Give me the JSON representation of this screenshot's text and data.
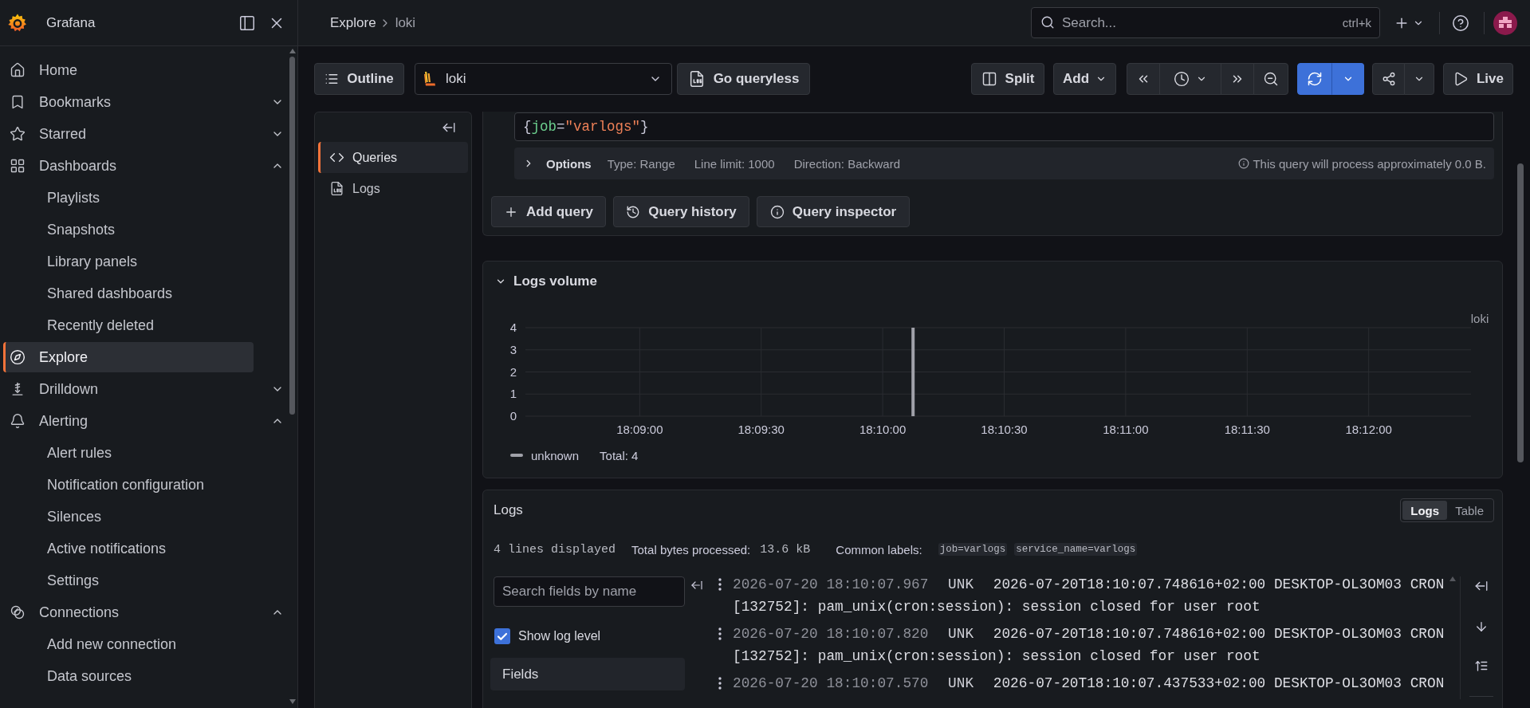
{
  "sidebar": {
    "title": "Grafana",
    "items": [
      {
        "label": "Home",
        "selected": false
      },
      {
        "label": "Bookmarks",
        "selected": false,
        "expanded": false
      },
      {
        "label": "Starred",
        "selected": false,
        "expanded": false
      },
      {
        "label": "Dashboards",
        "selected": false,
        "expanded": true,
        "children": [
          {
            "label": "Playlists",
            "selected": false
          },
          {
            "label": "Snapshots",
            "selected": false
          },
          {
            "label": "Library panels",
            "selected": false
          },
          {
            "label": "Shared dashboards",
            "selected": false
          },
          {
            "label": "Recently deleted",
            "selected": false
          }
        ]
      },
      {
        "label": "Explore",
        "selected": true
      },
      {
        "label": "Drilldown",
        "selected": false,
        "expanded": false
      },
      {
        "label": "Alerting",
        "selected": false,
        "expanded": true,
        "children": [
          {
            "label": "Alert rules",
            "selected": false
          },
          {
            "label": "Notification configuration",
            "selected": false
          },
          {
            "label": "Silences",
            "selected": false
          },
          {
            "label": "Active notifications",
            "selected": false
          },
          {
            "label": "Settings",
            "selected": false
          }
        ]
      },
      {
        "label": "Connections",
        "selected": false,
        "expanded": true,
        "children": [
          {
            "label": "Add new connection",
            "selected": false
          },
          {
            "label": "Data sources",
            "selected": false
          }
        ]
      }
    ]
  },
  "top_bar": {
    "breadcrumbs": [
      {
        "label": "Explore",
        "current": false
      },
      {
        "label": "loki",
        "current": true
      }
    ],
    "search": {
      "placeholder": "Search...",
      "shortcut": "ctrl+k"
    }
  },
  "toolbar": {
    "outline_button": "Outline",
    "datasource": "loki",
    "queryless_button": "Go queryless",
    "split_button": "Split",
    "add_button": "Add",
    "live_button": "Live"
  },
  "outline": {
    "items": [
      {
        "label": "Queries",
        "selected": true
      },
      {
        "label": "Logs",
        "selected": false
      }
    ]
  },
  "query": {
    "tokens": [
      {
        "kind": "punct",
        "text": "{"
      },
      {
        "kind": "label",
        "text": "job"
      },
      {
        "kind": "operator",
        "text": "="
      },
      {
        "kind": "string",
        "text": "\"varlogs\""
      },
      {
        "kind": "punct",
        "text": "}"
      }
    ],
    "options": {
      "label": "Options",
      "expanded": false,
      "summary": [
        "Type: Range",
        "Line limit: 1000",
        "Direction: Backward"
      ],
      "note": "This query will process approximately 0.0 B."
    },
    "actions": [
      "Add query",
      "Query history",
      "Query inspector"
    ]
  },
  "logs_volume": {
    "title": "Logs volume",
    "expanded": true,
    "source_label": "loki",
    "chart_data": {
      "type": "bar",
      "grid": true,
      "categories": [
        null,
        null,
        null,
        "18:09:00",
        null,
        null,
        null,
        "18:09:30",
        null,
        null,
        null,
        "18:10:00",
        null,
        null,
        null,
        "18:10:30",
        null,
        null,
        null,
        "18:11:00",
        null,
        null,
        null,
        "18:11:30",
        null,
        null,
        null,
        "18:12:00",
        null,
        null,
        null
      ],
      "series": [
        {
          "name": "unknown",
          "color": "#a0a1a9",
          "values": [
            null,
            null,
            null,
            null,
            null,
            null,
            null,
            null,
            null,
            null,
            null,
            null,
            4,
            null,
            null,
            null,
            null,
            null,
            null,
            null,
            null,
            null,
            null,
            null,
            null,
            null,
            null,
            null,
            null,
            null,
            null
          ]
        }
      ],
      "ylim": [
        0,
        4
      ],
      "yticks": [
        0,
        1,
        2,
        3,
        4
      ]
    },
    "total": "Total: 4"
  },
  "logs": {
    "title": "Logs",
    "views": [
      {
        "label": "Logs",
        "selected": true
      },
      {
        "label": "Table",
        "selected": false
      }
    ],
    "stats": {
      "lines": "4 lines displayed",
      "bytes_label": "Total bytes processed:",
      "bytes_value": "13.6 kB",
      "labels_label": "Common labels:",
      "common_labels": [
        "job=varlogs",
        "service_name=varlogs"
      ]
    },
    "fields": {
      "search_placeholder": "Search fields by name",
      "show_log_level": {
        "label": "Show log level",
        "checked": true
      },
      "header": "Fields"
    },
    "lines": [
      {
        "timestamp": "2026-07-20 18:10:07.967",
        "level": "UNK",
        "message": "2026-07-20T18:10:07.748616+02:00 DESKTOP-OL3OM03 CRON[132752]: pam_unix(cron:session): session closed for user root"
      },
      {
        "timestamp": "2026-07-20 18:10:07.820",
        "level": "UNK",
        "message": "2026-07-20T18:10:07.748616+02:00 DESKTOP-OL3OM03 CRON[132752]: pam_unix(cron:session): session closed for user root"
      },
      {
        "timestamp": "2026-07-20 18:10:07.570",
        "level": "UNK",
        "message": "2026-07-20T18:10:07.437533+02:00 DESKTOP-OL3OM03 CRON"
      }
    ]
  }
}
